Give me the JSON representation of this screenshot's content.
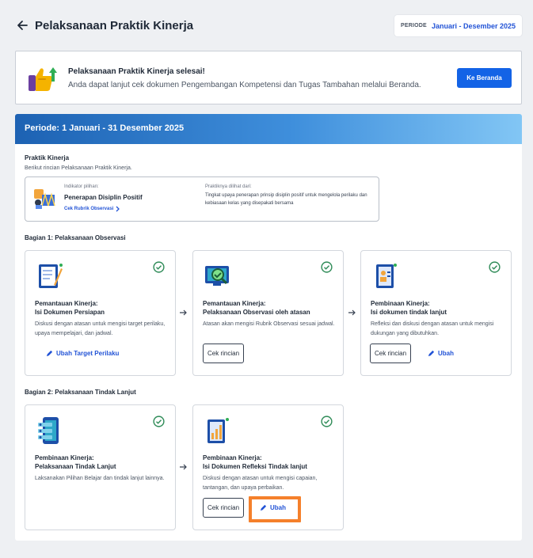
{
  "header": {
    "title": "Pelaksanaan Praktik Kinerja",
    "period_label": "PERIODE",
    "period_value": "Januari - Desember 2025"
  },
  "notice": {
    "title": "Pelaksanaan Praktik Kinerja selesai!",
    "message": "Anda dapat lanjut cek dokumen Pengembangan Kompetensi dan Tugas Tambahan melalui Beranda.",
    "button_label": "Ke Beranda"
  },
  "banner": {
    "text": "Periode: 1 Januari - 31 Desember 2025"
  },
  "praktik": {
    "title": "Praktik Kinerja",
    "subtitle": "Berikut rincian Pelaksanaan Praktik Kinerja.",
    "indicator_label": "Indikator pilihan:",
    "indicator_value": "Penerapan Disiplin Positif",
    "rubrik_link": "Cek Rubrik Observasi",
    "seen_label": "Praktiknya dilihat dari:",
    "seen_value": "Tingkat upaya penerapan prinsip disiplin positif untuk mengelola perilaku dan kebiasaan kelas yang disepakati bersama"
  },
  "bagian1": {
    "title": "Bagian 1: Pelaksanaan Observasi",
    "cards": [
      {
        "title1": "Pemantauan Kinerja:",
        "title2": "Isi Dokumen Persiapan",
        "desc": "Diskusi dengan atasan untuk mengisi target perilaku, upaya mempelajari, dan jadwal.",
        "link_label": "Ubah Target Perilaku"
      },
      {
        "title1": "Pemantauan Kinerja:",
        "title2": "Pelaksanaan Observasi oleh atasan",
        "desc": "Atasan akan mengisi Rubrik Observasi sesuai jadwal.",
        "button_label": "Cek rincian"
      },
      {
        "title1": "Pembinaan Kinerja:",
        "title2": "Isi dokumen tindak lanjut",
        "desc": "Refleksi dan diskusi dengan atasan untuk mengisi dukungan yang dibutuhkan.",
        "button_label": "Cek rincian",
        "link_label": "Ubah"
      }
    ]
  },
  "bagian2": {
    "title": "Bagian 2: Pelaksanaan Tindak Lanjut",
    "cards": [
      {
        "title1": "Pembinaan Kinerja:",
        "title2": "Pelaksanaan Tindak Lanjut",
        "desc": "Laksanakan Pilihan Belajar dan tindak lanjut lainnya."
      },
      {
        "title1": "Pembinaan Kinerja:",
        "title2": "Isi Dokumen Refleksi Tindak lanjut",
        "desc": "Diskusi dengan atasan untuk mengisi capaian, tantangan, dan upaya perbaikan.",
        "button_label": "Cek rincian",
        "link_label": "Ubah"
      }
    ]
  },
  "colors": {
    "accent": "#1363e6",
    "link": "#2253d6",
    "success": "#2e8b57",
    "highlight": "#f5802b"
  }
}
